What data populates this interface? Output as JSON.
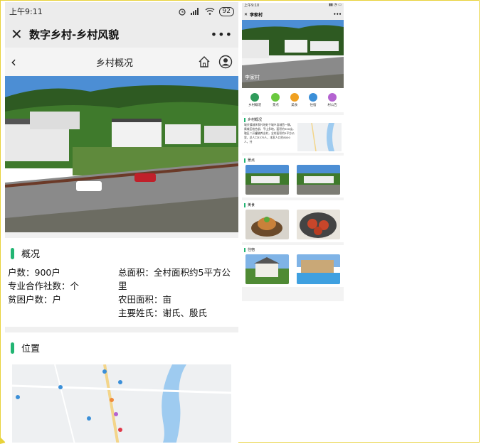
{
  "main": {
    "status_time": "上午9:11",
    "battery": "92",
    "window_title": "数字乡村-乡村风貌",
    "nav_title": "乡村概况",
    "overview_heading": "概况",
    "overview_left": [
      "户数：900户",
      "专业合作社数：个",
      "贫困户数：户"
    ],
    "overview_right": [
      "总面积：全村面积约5平方公里",
      "农田面积：亩",
      "主要姓氏：谢氏、殷氏"
    ],
    "location_heading": "位置"
  },
  "preview": {
    "status_time": "上午9:10",
    "window_title": "李家村",
    "hero_label": "李家村",
    "icons": [
      {
        "label": "乡村概况",
        "color": "#2f9b5b"
      },
      {
        "label": "景点",
        "color": "#6ac93f"
      },
      {
        "label": "美食",
        "color": "#f0a020"
      },
      {
        "label": "住宿",
        "color": "#3b8fd8"
      },
      {
        "label": "村公告",
        "color": "#b463d1"
      }
    ],
    "overview_heading": "乡村概况",
    "overview_text": "城关镇城李家村地处于城乡县城西一隅，属城区结合部，平山多地，面积约500亩，辖区二开罐佛养业村，全村面积约5平方公里，总人口3375人，本家人口约8000人，共",
    "sections": [
      "景点",
      "美食",
      "住宿"
    ]
  }
}
